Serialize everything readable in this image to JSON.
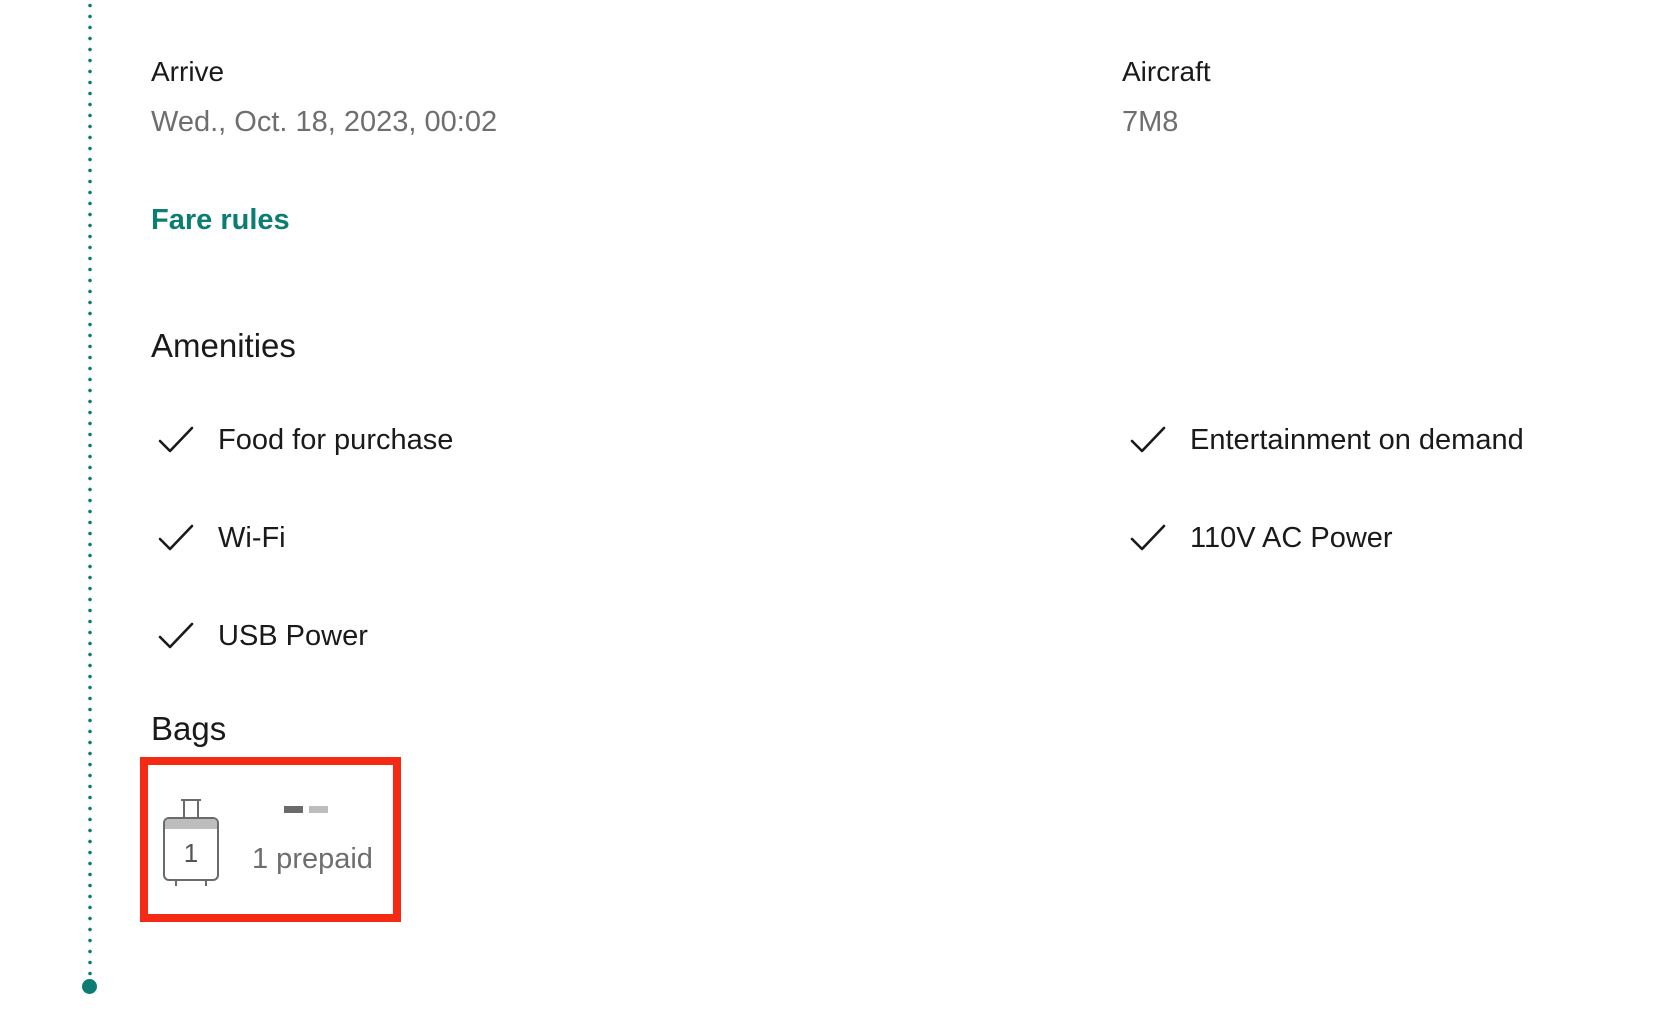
{
  "flight_details": {
    "arrive_label": "Arrive",
    "arrive_value": "Wed., Oct. 18, 2023, 00:02",
    "aircraft_label": "Aircraft",
    "aircraft_value": "7M8",
    "fare_rules_link": "Fare rules"
  },
  "amenities": {
    "title": "Amenities",
    "items": [
      {
        "label": "Food for purchase",
        "icon": "check-icon"
      },
      {
        "label": "Entertainment on demand",
        "icon": "check-icon"
      },
      {
        "label": "Wi-Fi",
        "icon": "check-icon"
      },
      {
        "label": "110V AC Power",
        "icon": "check-icon"
      },
      {
        "label": "USB Power",
        "icon": "check-icon"
      }
    ]
  },
  "bags": {
    "title": "Bags",
    "count": "1",
    "status": "1 prepaid",
    "icon": "suitcase-icon"
  },
  "colors": {
    "accent": "#0c7d72",
    "highlight": "#f52a14",
    "muted_text": "#6e6e6e"
  }
}
